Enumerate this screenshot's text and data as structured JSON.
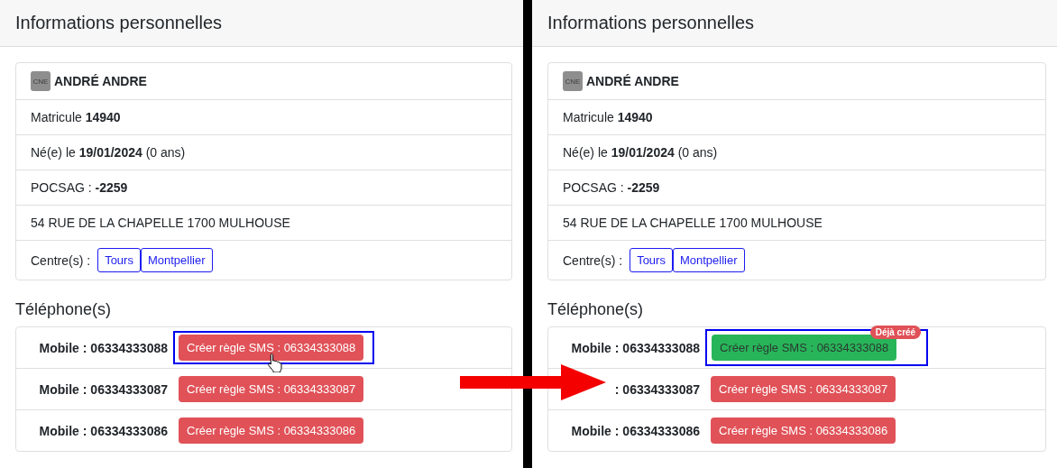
{
  "panels": [
    {
      "title": "Informations personnelles",
      "identity": {
        "badge": "CNE",
        "name": "ANDRÉ ANDRE"
      },
      "fields": [
        "Matricule **14940**",
        "Né(e) le **19/01/2024** (0 ans)",
        "POCSAG : **-2259**",
        "54 RUE DE LA CHAPELLE 1700 MULHOUSE"
      ],
      "centres": {
        "label": "Centre(s) :",
        "items": [
          "Tours",
          "Montpellier"
        ]
      },
      "phones_heading": "Téléphone(s)",
      "phones": [
        {
          "label": "Mobile : 06334333088",
          "button": "Créer règle SMS : 06334333088",
          "created": false,
          "outlined": true,
          "pointer": true
        },
        {
          "label": "Mobile : 06334333087",
          "button": "Créer règle SMS : 06334333087",
          "created": false,
          "outlined": false,
          "pointer": false
        },
        {
          "label": "Mobile : 06334333086",
          "button": "Créer règle SMS : 06334333086",
          "created": false,
          "outlined": false,
          "pointer": false
        }
      ]
    },
    {
      "title": "Informations personnelles",
      "identity": {
        "badge": "CNE",
        "name": "ANDRÉ ANDRE"
      },
      "fields": [
        "Matricule **14940**",
        "Né(e) le **19/01/2024** (0 ans)",
        "POCSAG : **-2259**",
        "54 RUE DE LA CHAPELLE 1700 MULHOUSE"
      ],
      "centres": {
        "label": "Centre(s) :",
        "items": [
          "Tours",
          "Montpellier"
        ]
      },
      "phones_heading": "Téléphone(s)",
      "phones": [
        {
          "label": "Mobile : 06334333088",
          "button": "Créer règle SMS : 06334333088",
          "created": true,
          "badge": "Déjà créé",
          "outlined": true,
          "pointer": false
        },
        {
          "label": ": 06334333087",
          "button": "Créer règle SMS : 06334333087",
          "created": false,
          "outlined": false,
          "pointer": false
        },
        {
          "label": "Mobile : 06334333086",
          "button": "Créer règle SMS : 06334333086",
          "created": false,
          "outlined": false,
          "pointer": false
        }
      ]
    }
  ]
}
